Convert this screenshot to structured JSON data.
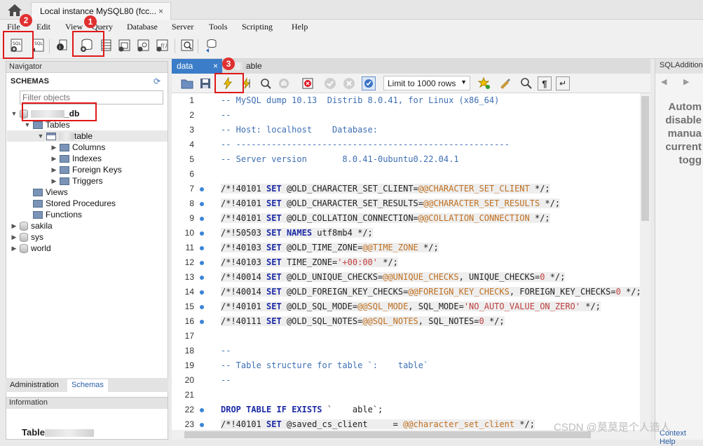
{
  "window": {
    "tab_title": "Local instance MySQL80 (fcc...",
    "tab_close": "×"
  },
  "menu": [
    "File",
    "Edit",
    "View",
    "Query",
    "Database",
    "Server",
    "Tools",
    "Scripting",
    "Help"
  ],
  "annotations": {
    "badge1": "1",
    "badge2": "2",
    "badge3": "3"
  },
  "navigator": {
    "header": "Navigator",
    "schemas_label": "SCHEMAS",
    "filter_placeholder": "Filter objects",
    "selected_db": "_db",
    "tables_label": "Tables",
    "table_name": "table",
    "columns": "Columns",
    "indexes": "Indexes",
    "foreign_keys": "Foreign Keys",
    "triggers": "Triggers",
    "views": "Views",
    "stored_procedures": "Stored Procedures",
    "functions": "Functions",
    "other_schemas": [
      "sakila",
      "sys",
      "world"
    ]
  },
  "bottom_tabs": {
    "administration": "Administration",
    "schemas": "Schemas"
  },
  "info": {
    "header": "Information",
    "table_label": "Table"
  },
  "editor": {
    "tab_data": "data",
    "tab_close": "×",
    "tab_second": "able",
    "limit_select": "Limit to 1000 rows"
  },
  "code_lines": [
    {
      "n": "1",
      "dot": false,
      "text": "-- MySQL dump 10.13  Distrib 8.0.41, for Linux (x86_64)"
    },
    {
      "n": "2",
      "dot": false,
      "text": "--"
    },
    {
      "n": "3",
      "dot": false,
      "text": "-- Host: localhost    Database: "
    },
    {
      "n": "4",
      "dot": false,
      "text": "-- ------------------------------------------------------"
    },
    {
      "n": "5",
      "dot": false,
      "text": "-- Server version\t8.0.41-0ubuntu0.22.04.1"
    },
    {
      "n": "6",
      "dot": false,
      "text": ""
    },
    {
      "n": "7",
      "dot": true,
      "text": "/*!40101 SET @OLD_CHARACTER_SET_CLIENT=@@CHARACTER_SET_CLIENT */;"
    },
    {
      "n": "8",
      "dot": true,
      "text": "/*!40101 SET @OLD_CHARACTER_SET_RESULTS=@@CHARACTER_SET_RESULTS */;"
    },
    {
      "n": "9",
      "dot": true,
      "text": "/*!40101 SET @OLD_COLLATION_CONNECTION=@@COLLATION_CONNECTION */;"
    },
    {
      "n": "10",
      "dot": true,
      "text": "/*!50503 SET NAMES utf8mb4 */;"
    },
    {
      "n": "11",
      "dot": true,
      "text": "/*!40103 SET @OLD_TIME_ZONE=@@TIME_ZONE */;"
    },
    {
      "n": "12",
      "dot": true,
      "text": "/*!40103 SET TIME_ZONE='+00:00' */;"
    },
    {
      "n": "13",
      "dot": true,
      "text": "/*!40014 SET @OLD_UNIQUE_CHECKS=@@UNIQUE_CHECKS, UNIQUE_CHECKS=0 */;"
    },
    {
      "n": "14",
      "dot": true,
      "text": "/*!40014 SET @OLD_FOREIGN_KEY_CHECKS=@@FOREIGN_KEY_CHECKS, FOREIGN_KEY_CHECKS=0 */;"
    },
    {
      "n": "15",
      "dot": true,
      "text": "/*!40101 SET @OLD_SQL_MODE=@@SQL_MODE, SQL_MODE='NO_AUTO_VALUE_ON_ZERO' */;"
    },
    {
      "n": "16",
      "dot": true,
      "text": "/*!40111 SET @OLD_SQL_NOTES=@@SQL_NOTES, SQL_NOTES=0 */;"
    },
    {
      "n": "17",
      "dot": false,
      "text": ""
    },
    {
      "n": "18",
      "dot": false,
      "text": "--"
    },
    {
      "n": "19",
      "dot": false,
      "text": "-- Table structure for table `:    table`"
    },
    {
      "n": "20",
      "dot": false,
      "text": "--"
    },
    {
      "n": "21",
      "dot": false,
      "text": ""
    },
    {
      "n": "22",
      "dot": true,
      "text": "DROP TABLE IF EXISTS `    able`;"
    },
    {
      "n": "23",
      "dot": true,
      "text": "/*!40101 SET @saved_cs_client     = @@character_set_client */;"
    }
  ],
  "right_panel": {
    "header": "SQLAdditions",
    "help_lines": [
      "Autom",
      "disable",
      "manua",
      "current",
      "togg"
    ],
    "context_help": "Context Help"
  },
  "watermark": "CSDN @莫莫是个人造人"
}
